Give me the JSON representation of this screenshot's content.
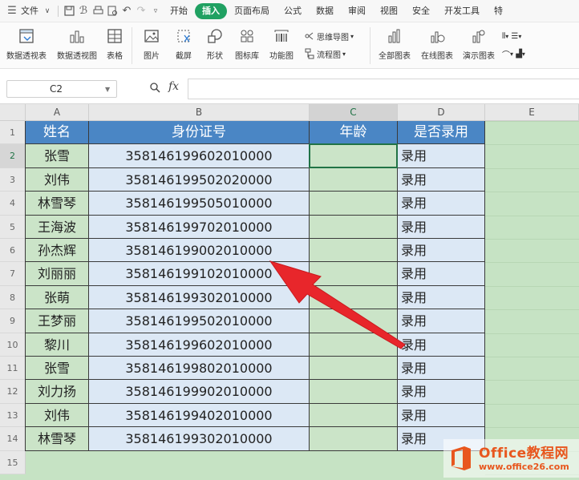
{
  "menubar": {
    "file_label": "文件",
    "items": [
      "开始",
      "插入",
      "页面布局",
      "公式",
      "数据",
      "审阅",
      "视图",
      "安全",
      "开发工具",
      "特"
    ],
    "active_index": 1,
    "active_color": "#20a162"
  },
  "ribbon": {
    "buttons": [
      {
        "label": "数据透视表",
        "icon": "pivot-table-icon"
      },
      {
        "label": "数据透视图",
        "icon": "pivot-chart-icon"
      },
      {
        "label": "表格",
        "icon": "table-icon"
      },
      {
        "label": "图片",
        "icon": "picture-icon"
      },
      {
        "label": "截屏",
        "icon": "screenshot-icon"
      },
      {
        "label": "形状",
        "icon": "shape-icon"
      },
      {
        "label": "图标库",
        "icon": "icon-library-icon"
      },
      {
        "label": "功能图",
        "icon": "barcode-icon"
      }
    ],
    "small_buttons": [
      {
        "label": "思维导图",
        "icon": "mindmap-icon"
      },
      {
        "label": "流程图",
        "icon": "flowchart-icon"
      }
    ],
    "right_buttons": [
      {
        "label": "全部图表",
        "icon": "all-charts-icon"
      },
      {
        "label": "在线图表",
        "icon": "online-charts-icon"
      },
      {
        "label": "演示图表",
        "icon": "demo-charts-icon"
      }
    ]
  },
  "formula_bar": {
    "name_box": "C2",
    "fx_label": "fx",
    "content": ""
  },
  "sheet": {
    "columns": [
      "A",
      "B",
      "C",
      "D",
      "E"
    ],
    "selected_column": "C",
    "row_numbers": [
      "1",
      "2",
      "3",
      "4",
      "5",
      "6",
      "7",
      "8",
      "9",
      "10",
      "11",
      "12",
      "13",
      "14",
      "15"
    ],
    "selected_row": "2",
    "headers": [
      "姓名",
      "身份证号",
      "年龄",
      "是否录用"
    ],
    "rows": [
      {
        "name": "张雪",
        "id": "358146199602010000",
        "age": "",
        "hired": "录用"
      },
      {
        "name": "刘伟",
        "id": "358146199502020000",
        "age": "",
        "hired": "录用"
      },
      {
        "name": "林雪琴",
        "id": "358146199505010000",
        "age": "",
        "hired": "录用"
      },
      {
        "name": "王海波",
        "id": "358146199702010000",
        "age": "",
        "hired": "录用"
      },
      {
        "name": "孙杰辉",
        "id": "358146199002010000",
        "age": "",
        "hired": "录用"
      },
      {
        "name": "刘丽丽",
        "id": "358146199102010000",
        "age": "",
        "hired": "录用"
      },
      {
        "name": "张萌",
        "id": "358146199302010000",
        "age": "",
        "hired": "录用"
      },
      {
        "name": "王梦丽",
        "id": "358146199502010000",
        "age": "",
        "hired": "录用"
      },
      {
        "name": "黎川",
        "id": "358146199602010000",
        "age": "",
        "hired": "录用"
      },
      {
        "name": "张雪",
        "id": "358146199802010000",
        "age": "",
        "hired": "录用"
      },
      {
        "name": "刘力扬",
        "id": "358146199902010000",
        "age": "",
        "hired": "录用"
      },
      {
        "name": "刘伟",
        "id": "358146199402010000",
        "age": "",
        "hired": "录用"
      },
      {
        "name": "林雪琴",
        "id": "358146199302010000",
        "age": "",
        "hired": "录用"
      }
    ],
    "header_color": "#4a86c5",
    "annotation_arrow_color": "#e8262b"
  },
  "watermark": {
    "line1": "Office教程网",
    "line2": "www.office26.com"
  }
}
